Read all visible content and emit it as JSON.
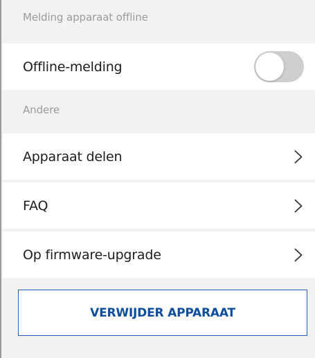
{
  "sections": {
    "offline_header": "Melding apparaat offline",
    "other_header": "Andere"
  },
  "offline_notification": {
    "label": "Offline-melding",
    "enabled": false
  },
  "menu_items": [
    {
      "label": "Apparaat delen",
      "icon": "chevron-right-icon"
    },
    {
      "label": "FAQ",
      "icon": "chevron-right-icon"
    },
    {
      "label": "Op firmware-upgrade",
      "icon": "chevron-right-icon"
    }
  ],
  "remove_device": {
    "label": "VERWIJDER APPARAAT",
    "color": "#0d4d9e"
  },
  "colors": {
    "background": "#f2f2f2",
    "row_background": "#ffffff",
    "toggle_off": "#cfcfcf",
    "accent": "#1f5fb3"
  }
}
